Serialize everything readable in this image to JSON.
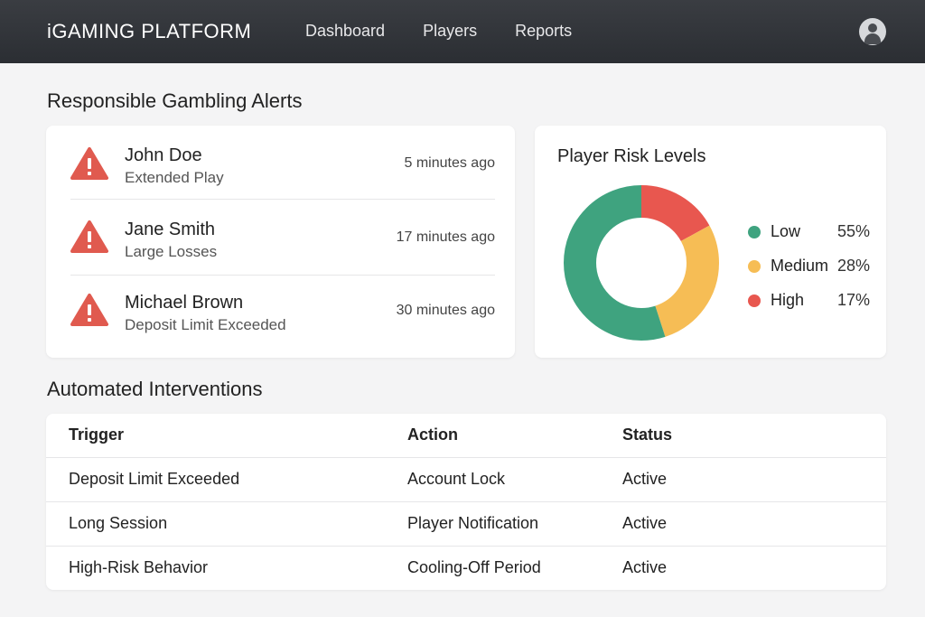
{
  "header": {
    "brand": "iGAMING PLATFORM",
    "nav": [
      "Dashboard",
      "Players",
      "Reports"
    ]
  },
  "alerts": {
    "title": "Responsible Gambling Alerts",
    "items": [
      {
        "name": "John Doe",
        "reason": "Extended Play",
        "time": "5 minutes ago"
      },
      {
        "name": "Jane Smith",
        "reason": "Large Losses",
        "time": "17 minutes ago"
      },
      {
        "name": "Michael Brown",
        "reason": "Deposit Limit Exceeded",
        "time": "30 minutes ago"
      }
    ],
    "icon": "warning-triangle-icon",
    "icon_color": "#e05a4f"
  },
  "risk": {
    "title": "Player Risk Levels",
    "segments": [
      {
        "label": "Low",
        "pct": "55%",
        "value": 55,
        "color": "#3fa37f"
      },
      {
        "label": "Medium",
        "pct": "28%",
        "value": 28,
        "color": "#f6bd55"
      },
      {
        "label": "High",
        "pct": "17%",
        "value": 17,
        "color": "#e8574f"
      }
    ]
  },
  "interventions": {
    "title": "Automated Interventions",
    "headers": [
      "Trigger",
      "Action",
      "Status"
    ],
    "rows": [
      [
        "Deposit Limit Exceeded",
        "Account Lock",
        "Active"
      ],
      [
        "Long Session",
        "Player Notification",
        "Active"
      ],
      [
        "High-Risk Behavior",
        "Cooling-Off Period",
        "Active"
      ]
    ]
  },
  "colors": {
    "topbar": "#2f3237",
    "background": "#f4f4f5"
  }
}
